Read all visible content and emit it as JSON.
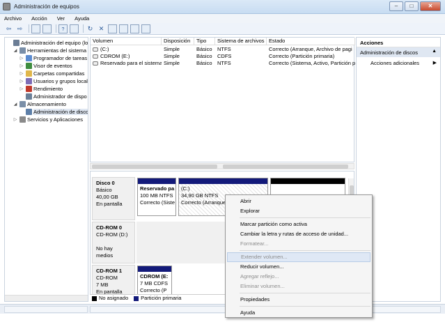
{
  "window": {
    "title": "Administración de equipos",
    "min": "–",
    "max": "□",
    "close": "✕"
  },
  "menu": [
    "Archivo",
    "Acción",
    "Ver",
    "Ayuda"
  ],
  "toolbar": {
    "icons": [
      "back-arrow-icon",
      "forward-arrow-icon",
      "up-folder-icon",
      "console-tree-icon",
      "help-icon",
      "properties-icon",
      "refresh-icon",
      "delete-icon",
      "export-icon",
      "open-icon",
      "search-icon",
      "settings-icon"
    ],
    "glyphs": [
      "⇦",
      "⇨",
      "📁",
      "▦",
      "?",
      "▣",
      "↻",
      "✕",
      "⊞",
      "⎘",
      "🔍",
      "⚙"
    ]
  },
  "tree": [
    {
      "label": "Administración del equipo (loc",
      "indent": 0,
      "exp": "",
      "color": "#6b7d95"
    },
    {
      "label": "Herramientas del sistema",
      "indent": 1,
      "exp": "◢",
      "color": "#7a8fa8"
    },
    {
      "label": "Programador de tareas",
      "indent": 2,
      "exp": "▷",
      "color": "#5b8bd0"
    },
    {
      "label": "Visor de eventos",
      "indent": 2,
      "exp": "▷",
      "color": "#3f8d3f"
    },
    {
      "label": "Carpetas compartidas",
      "indent": 2,
      "exp": "▷",
      "color": "#e0b64a"
    },
    {
      "label": "Usuarios y grupos locale",
      "indent": 2,
      "exp": "▷",
      "color": "#7d6cb6"
    },
    {
      "label": "Rendimiento",
      "indent": 2,
      "exp": "▷",
      "color": "#c0392b"
    },
    {
      "label": "Administrador de dispo",
      "indent": 2,
      "exp": "",
      "color": "#6a7f98"
    },
    {
      "label": "Almacenamiento",
      "indent": 1,
      "exp": "◢",
      "color": "#7a8fa8"
    },
    {
      "label": "Administración de disco",
      "indent": 2,
      "exp": "",
      "color": "#5d7fa8",
      "selected": true
    },
    {
      "label": "Servicios y Aplicaciones",
      "indent": 1,
      "exp": "▷",
      "color": "#8a8a8a"
    }
  ],
  "volumes": {
    "headers": [
      "Volumen",
      "Disposición",
      "Tipo",
      "Sistema de archivos",
      "Estado"
    ],
    "rows": [
      [
        "(C:)",
        "Simple",
        "Básico",
        "NTFS",
        "Correcto (Arranque, Archivo de pagi"
      ],
      [
        "CDROM (E:)",
        "Simple",
        "Básico",
        "CDFS",
        "Correcto (Partición primaria)"
      ],
      [
        "Reservado para el sistema",
        "Simple",
        "Básico",
        "NTFS",
        "Correcto (Sistema, Activo, Partición p"
      ]
    ]
  },
  "disks": [
    {
      "name": "Disco 0",
      "lines": [
        "Básico",
        "40,00 GB",
        "En pantalla"
      ]
    },
    {
      "name": "CD-ROM 0",
      "lines": [
        "CD-ROM (D:)",
        "",
        "No hay medios"
      ]
    },
    {
      "name": "CD-ROM 1",
      "lines": [
        "CD-ROM",
        "7 MB",
        "En pantalla"
      ]
    }
  ],
  "partitions": {
    "reserved": {
      "name": "Reservado pa",
      "size": "100 MB NTFS",
      "status": "Correcto (Siste"
    },
    "c": {
      "name": "(C:)",
      "size": "34,90 GB NTFS",
      "status": "Correcto (Arranque"
    },
    "cdrom": {
      "name": "CDROM  (E:",
      "size": "7 MB CDFS",
      "status": "Correcto (P"
    }
  },
  "legend": [
    {
      "label": "No asignado",
      "color": "#000000"
    },
    {
      "label": "Partición primaria",
      "color": "#131a7a"
    }
  ],
  "actions": {
    "title": "Acciones",
    "section": "Administración de discos",
    "more": "Acciones adicionales",
    "arrow_up": "▲",
    "arrow_right": "▶"
  },
  "context_menu": {
    "groups": [
      [
        {
          "label": "Abrir",
          "enabled": true
        },
        {
          "label": "Explorar",
          "enabled": true
        }
      ],
      [
        {
          "label": "Marcar partición como activa",
          "enabled": true
        },
        {
          "label": "Cambiar la letra y rutas de acceso de unidad...",
          "enabled": true
        },
        {
          "label": "Formatear...",
          "enabled": false
        }
      ],
      [
        {
          "label": "Extender volumen...",
          "enabled": false,
          "highlight": true
        },
        {
          "label": "Reducir volumen...",
          "enabled": true
        },
        {
          "label": "Agregar reflejo...",
          "enabled": false
        },
        {
          "label": "Eliminar volumen...",
          "enabled": false
        }
      ],
      [
        {
          "label": "Propiedades",
          "enabled": true
        }
      ],
      [
        {
          "label": "Ayuda",
          "enabled": true
        }
      ]
    ]
  }
}
